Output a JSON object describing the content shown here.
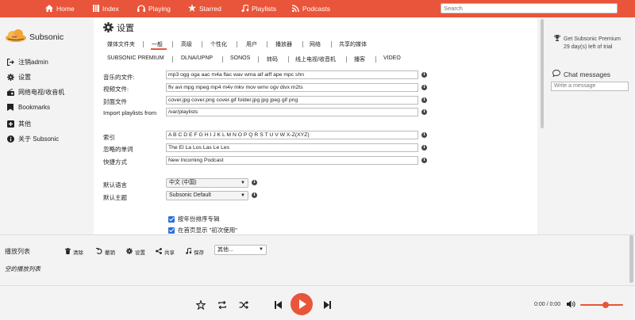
{
  "nav": {
    "items": [
      {
        "label": "Home",
        "icon": "home-icon"
      },
      {
        "label": "Index",
        "icon": "index-icon"
      },
      {
        "label": "Playing",
        "icon": "headphones-icon"
      },
      {
        "label": "Starred",
        "icon": "star-icon"
      },
      {
        "label": "Playlists",
        "icon": "music-note-icon"
      },
      {
        "label": "Podcasts",
        "icon": "rss-icon"
      }
    ],
    "search_placeholder": "Search"
  },
  "sidebar": {
    "app_name": "Subsonic",
    "items": [
      {
        "label": "注销admin",
        "icon": "logout-icon"
      },
      {
        "label": "设置",
        "icon": "gear-icon"
      },
      {
        "label": "网络电视/收音机",
        "icon": "radio-icon"
      },
      {
        "label": "Bookmarks",
        "icon": "bookmark-icon"
      },
      {
        "label": "其他",
        "icon": "plus-square-icon"
      },
      {
        "label": "关于 Subsonic",
        "icon": "info-icon"
      }
    ]
  },
  "main": {
    "title": "设置",
    "tabs_row1": [
      "媒体文件夹",
      "一般",
      "高级",
      "个性化",
      "用户",
      "播放器",
      "网络",
      "共享的媒体"
    ],
    "tabs_row2": [
      "SUBSONIC PREMIUM",
      "DLNA/UPNP",
      "SONOS",
      "转码",
      "线上电视/收音机",
      "播客",
      "VIDEO"
    ],
    "active_tab": "一般",
    "fields": [
      {
        "label": "音乐的文件:",
        "value": "mp3 ogg oga aac m4a flac wav wma aif aiff ape mpc shn"
      },
      {
        "label": "视频文件:",
        "value": "flv avi mpg mpeg mp4 m4v mkv mov wmv ogv divx m2ts"
      },
      {
        "label": "封面文件",
        "value": "cover.jpg cover.png cover.gif folder.jpg jpg jpeg gif png"
      },
      {
        "label": "Import playlists from",
        "value": "/var/playlists"
      },
      {
        "label": "索引",
        "value": "A B C D E F G H I J K L M N O P Q R S T U V W X-Z(XYZ)"
      },
      {
        "label": "忽略的单词",
        "value": "The El La Los Las Le Les"
      },
      {
        "label": "快捷方式",
        "value": "New Incoming Podcast"
      }
    ],
    "language_label": "默认语言",
    "language_value": "中文 (中国)",
    "theme_label": "默认主题",
    "theme_value": "Subsonic Default",
    "checkboxes": [
      {
        "label": "按年份排序专辑",
        "checked": true
      },
      {
        "label": "在首页显示 \"初次使用\"",
        "checked": true
      }
    ]
  },
  "right": {
    "premium_line1": "Get Subsonic Premium",
    "premium_line2": "29 day(s) left of trial",
    "chat_title": "Chat messages",
    "chat_placeholder": "Write a message"
  },
  "playlist": {
    "title": "播放列表",
    "tools": [
      {
        "label": "清除",
        "icon": "trash-icon"
      },
      {
        "label": "撤销",
        "icon": "undo-icon"
      },
      {
        "label": "设置",
        "icon": "gear-icon"
      },
      {
        "label": "共享",
        "icon": "share-icon"
      },
      {
        "label": "保存",
        "icon": "music-note-icon"
      }
    ],
    "more_select": "其他...",
    "empty_text": "空的播放列表",
    "time": "0:00 / 0:00",
    "volume_level": 0.6
  },
  "colors": {
    "accent": "#e9553a",
    "checkbox": "#2a6fdb"
  }
}
